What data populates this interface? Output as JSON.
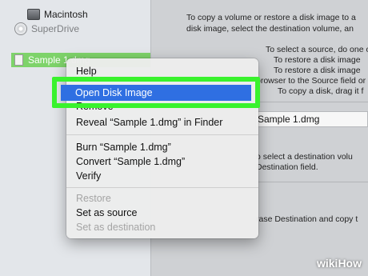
{
  "sidebar": {
    "devices": [
      {
        "label": "Macintosh",
        "icon": "disk-icon"
      },
      {
        "label": "SuperDrive",
        "icon": "disc-icon"
      }
    ],
    "selected_item": {
      "label": "Sample 1.dmg",
      "icon": "file-icon"
    }
  },
  "main": {
    "lines": [
      "To copy a volume or restore a disk image to a",
      "disk image, select the destination volume, an",
      "To select a source, do one of",
      "To restore a disk image",
      "To restore a disk image",
      "browser to the Source field or",
      "To copy a disk, drag it f",
      "o select a destination volu",
      "Destination field.",
      "rase Destination and copy t"
    ],
    "source_field_value": "Sample 1.dmg"
  },
  "context_menu": {
    "items": [
      {
        "label": "Help",
        "enabled": true
      },
      {
        "label": "Open Disk Image",
        "enabled": true,
        "highlighted": true
      },
      {
        "label": "Remove",
        "enabled": true
      },
      {
        "label": "Reveal “Sample 1.dmg” in Finder",
        "enabled": true
      },
      {
        "label": "Burn “Sample 1.dmg”",
        "enabled": true
      },
      {
        "label": "Convert “Sample 1.dmg”",
        "enabled": true
      },
      {
        "label": "Verify",
        "enabled": true
      },
      {
        "label": "Restore",
        "enabled": false
      },
      {
        "label": "Set as source",
        "enabled": true
      },
      {
        "label": "Set as destination",
        "enabled": false
      }
    ]
  },
  "watermark": {
    "wiki": "wiki",
    "how": "How"
  },
  "colors": {
    "highlight": "#2f6fe2",
    "annotation_outline": "#39f22d",
    "sidebar_selection": "#7ed36a"
  }
}
